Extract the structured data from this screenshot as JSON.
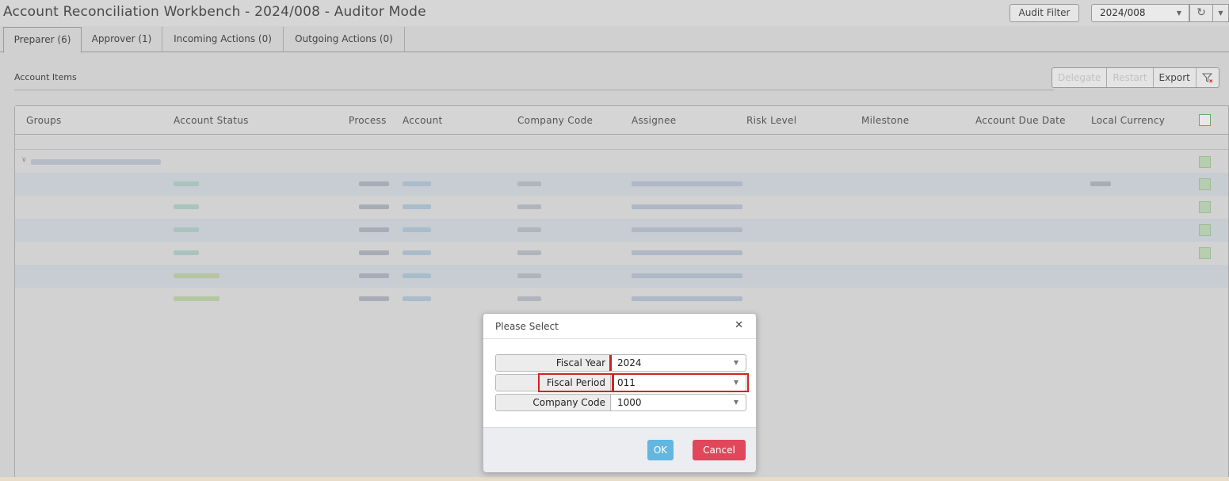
{
  "header": {
    "title": "Account Reconciliation Workbench - 2024/008 - Auditor Mode",
    "audit_filter_label": "Audit Filter",
    "period_value": "2024/008",
    "refresh_icon": "refresh-icon",
    "more_icon": "chevron-down-icon"
  },
  "tabs": [
    {
      "label": "Preparer (6)",
      "active": true
    },
    {
      "label": "Approver (1)",
      "active": false
    },
    {
      "label": "Incoming Actions (0)",
      "active": false
    },
    {
      "label": "Outgoing Actions (0)",
      "active": false
    }
  ],
  "panel": {
    "title": "Account Items",
    "toolbar": {
      "delegate_label": "Delegate",
      "restart_label": "Restart",
      "export_label": "Export",
      "filter_icon": "filter-clear-icon"
    }
  },
  "grid": {
    "columns": [
      "Groups",
      "Account Status",
      "Process",
      "Account",
      "Company Code",
      "Assignee",
      "Risk Level",
      "Milestone",
      "Account Due Date",
      "Local Currency"
    ],
    "rows_note_hidden": true
  },
  "modal": {
    "title": "Please Select",
    "close_icon": "close-icon",
    "fields": [
      {
        "label": "Fiscal Year",
        "value": "2024"
      },
      {
        "label": "Fiscal Period",
        "value": "011"
      },
      {
        "label": "Company Code",
        "value": "1000"
      }
    ],
    "ok_label": "OK",
    "cancel_label": "Cancel"
  },
  "colors": {
    "ok_button": "#62b6e0",
    "cancel_button": "#e0475a",
    "highlight": "#d32222"
  }
}
